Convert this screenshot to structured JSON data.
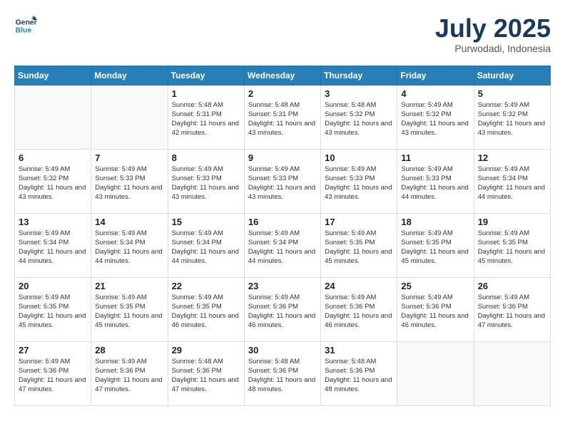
{
  "logo": {
    "line1": "General",
    "line2": "Blue"
  },
  "title": "July 2025",
  "location": "Purwodadi, Indonesia",
  "weekdays": [
    "Sunday",
    "Monday",
    "Tuesday",
    "Wednesday",
    "Thursday",
    "Friday",
    "Saturday"
  ],
  "weeks": [
    [
      {
        "day": "",
        "empty": true
      },
      {
        "day": "",
        "empty": true
      },
      {
        "day": "1",
        "sunrise": "5:48 AM",
        "sunset": "5:31 PM",
        "daylight": "11 hours and 42 minutes."
      },
      {
        "day": "2",
        "sunrise": "5:48 AM",
        "sunset": "5:31 PM",
        "daylight": "11 hours and 43 minutes."
      },
      {
        "day": "3",
        "sunrise": "5:48 AM",
        "sunset": "5:32 PM",
        "daylight": "11 hours and 43 minutes."
      },
      {
        "day": "4",
        "sunrise": "5:49 AM",
        "sunset": "5:32 PM",
        "daylight": "11 hours and 43 minutes."
      },
      {
        "day": "5",
        "sunrise": "5:49 AM",
        "sunset": "5:32 PM",
        "daylight": "11 hours and 43 minutes."
      }
    ],
    [
      {
        "day": "6",
        "sunrise": "5:49 AM",
        "sunset": "5:32 PM",
        "daylight": "11 hours and 43 minutes."
      },
      {
        "day": "7",
        "sunrise": "5:49 AM",
        "sunset": "5:33 PM",
        "daylight": "11 hours and 43 minutes."
      },
      {
        "day": "8",
        "sunrise": "5:49 AM",
        "sunset": "5:33 PM",
        "daylight": "11 hours and 43 minutes."
      },
      {
        "day": "9",
        "sunrise": "5:49 AM",
        "sunset": "5:33 PM",
        "daylight": "11 hours and 43 minutes."
      },
      {
        "day": "10",
        "sunrise": "5:49 AM",
        "sunset": "5:33 PM",
        "daylight": "11 hours and 43 minutes."
      },
      {
        "day": "11",
        "sunrise": "5:49 AM",
        "sunset": "5:33 PM",
        "daylight": "11 hours and 44 minutes."
      },
      {
        "day": "12",
        "sunrise": "5:49 AM",
        "sunset": "5:34 PM",
        "daylight": "11 hours and 44 minutes."
      }
    ],
    [
      {
        "day": "13",
        "sunrise": "5:49 AM",
        "sunset": "5:34 PM",
        "daylight": "11 hours and 44 minutes."
      },
      {
        "day": "14",
        "sunrise": "5:49 AM",
        "sunset": "5:34 PM",
        "daylight": "11 hours and 44 minutes."
      },
      {
        "day": "15",
        "sunrise": "5:49 AM",
        "sunset": "5:34 PM",
        "daylight": "11 hours and 44 minutes."
      },
      {
        "day": "16",
        "sunrise": "5:49 AM",
        "sunset": "5:34 PM",
        "daylight": "11 hours and 44 minutes."
      },
      {
        "day": "17",
        "sunrise": "5:49 AM",
        "sunset": "5:35 PM",
        "daylight": "11 hours and 45 minutes."
      },
      {
        "day": "18",
        "sunrise": "5:49 AM",
        "sunset": "5:35 PM",
        "daylight": "11 hours and 45 minutes."
      },
      {
        "day": "19",
        "sunrise": "5:49 AM",
        "sunset": "5:35 PM",
        "daylight": "11 hours and 45 minutes."
      }
    ],
    [
      {
        "day": "20",
        "sunrise": "5:49 AM",
        "sunset": "5:35 PM",
        "daylight": "11 hours and 45 minutes."
      },
      {
        "day": "21",
        "sunrise": "5:49 AM",
        "sunset": "5:35 PM",
        "daylight": "11 hours and 45 minutes."
      },
      {
        "day": "22",
        "sunrise": "5:49 AM",
        "sunset": "5:35 PM",
        "daylight": "11 hours and 46 minutes."
      },
      {
        "day": "23",
        "sunrise": "5:49 AM",
        "sunset": "5:36 PM",
        "daylight": "11 hours and 46 minutes."
      },
      {
        "day": "24",
        "sunrise": "5:49 AM",
        "sunset": "5:36 PM",
        "daylight": "11 hours and 46 minutes."
      },
      {
        "day": "25",
        "sunrise": "5:49 AM",
        "sunset": "5:36 PM",
        "daylight": "11 hours and 46 minutes."
      },
      {
        "day": "26",
        "sunrise": "5:49 AM",
        "sunset": "5:36 PM",
        "daylight": "11 hours and 47 minutes."
      }
    ],
    [
      {
        "day": "27",
        "sunrise": "5:49 AM",
        "sunset": "5:36 PM",
        "daylight": "11 hours and 47 minutes."
      },
      {
        "day": "28",
        "sunrise": "5:49 AM",
        "sunset": "5:36 PM",
        "daylight": "11 hours and 47 minutes."
      },
      {
        "day": "29",
        "sunrise": "5:48 AM",
        "sunset": "5:36 PM",
        "daylight": "11 hours and 47 minutes."
      },
      {
        "day": "30",
        "sunrise": "5:48 AM",
        "sunset": "5:36 PM",
        "daylight": "11 hours and 48 minutes."
      },
      {
        "day": "31",
        "sunrise": "5:48 AM",
        "sunset": "5:36 PM",
        "daylight": "11 hours and 48 minutes."
      },
      {
        "day": "",
        "empty": true
      },
      {
        "day": "",
        "empty": true
      }
    ]
  ]
}
